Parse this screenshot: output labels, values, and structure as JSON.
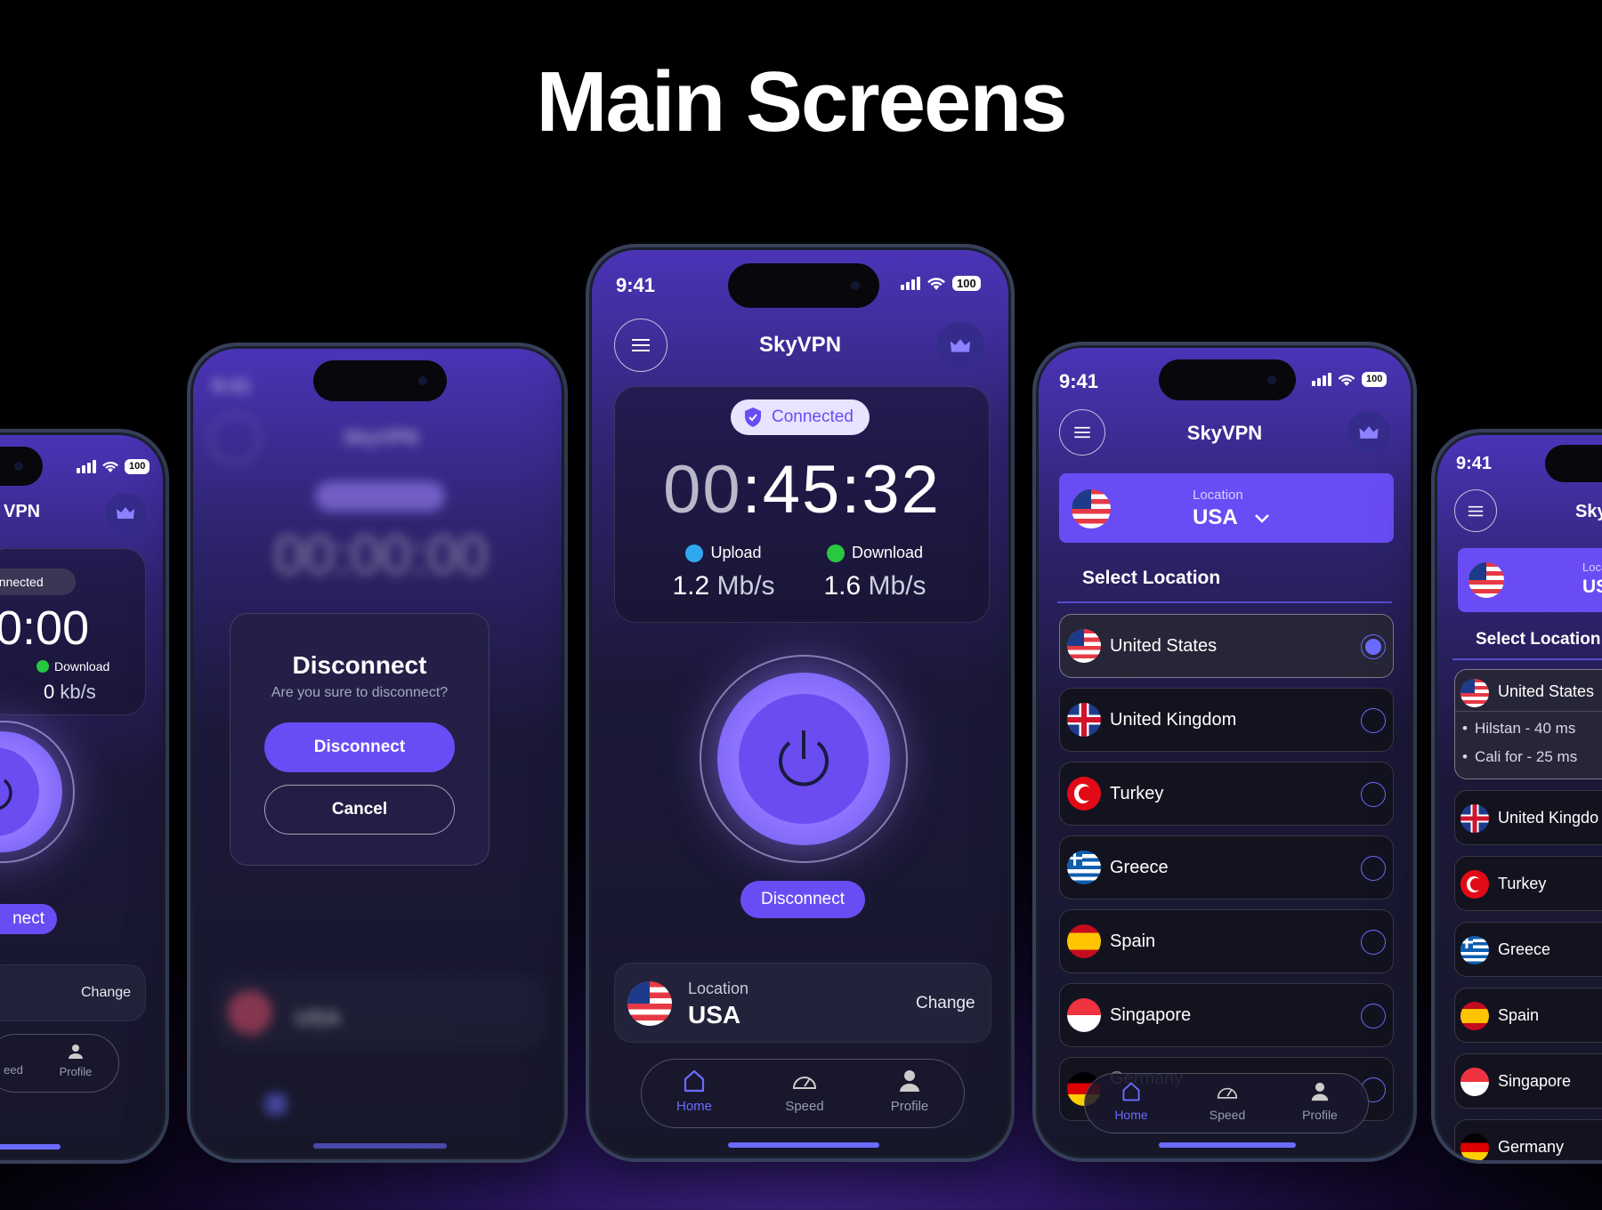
{
  "page_title": "Main Screens",
  "app_name": "SkyVPN",
  "status_time": "9:41",
  "battery": "100",
  "home_screen": {
    "status_label": "Connected",
    "timer_dim": "00",
    "timer_rest": ":45:32",
    "upload_label": "Upload",
    "upload_value": "1.2",
    "upload_unit": "Mb/s",
    "download_label": "Download",
    "download_value": "1.6",
    "download_unit": "Mb/s",
    "disconnect_label": "Disconnect",
    "location_label": "Location",
    "location_value": "USA",
    "change_label": "Change"
  },
  "tabs": {
    "home": "Home",
    "speed": "Speed",
    "profile": "Profile"
  },
  "left_screen": {
    "status_partial": "onnected",
    "timer_partial": "0:00",
    "download_label": "Download",
    "download_value": "0",
    "download_unit": "kb/s",
    "button_partial": "nect",
    "app_name_partial": "VPN",
    "change_label": "Change",
    "tab_partial": "eed"
  },
  "disconnect_dialog": {
    "blur_timer": "00:00:00",
    "blur_location": "USA",
    "title": "Disconnect",
    "message": "Are you sure to disconnect?",
    "confirm_label": "Disconnect",
    "cancel_label": "Cancel"
  },
  "location_screen": {
    "location_label": "Location",
    "location_value": "USA",
    "section_title": "Select Location",
    "countries": [
      {
        "name": "United States",
        "selected": true
      },
      {
        "name": "United Kingdom",
        "selected": false
      },
      {
        "name": "Turkey",
        "selected": false
      },
      {
        "name": "Greece",
        "selected": false
      },
      {
        "name": "Spain",
        "selected": false
      },
      {
        "name": "Singapore",
        "selected": false
      },
      {
        "name": "Germany",
        "selected": false
      }
    ]
  },
  "right_screen": {
    "app_name_partial": "Sky",
    "loc_label_partial": "Loca",
    "loc_value_partial": "US",
    "section_title_partial": "Select Location",
    "expanded_country": "United States",
    "servers": [
      "Hilstan - 40 ms",
      "Cali for - 25 ms"
    ],
    "countries_partial": [
      "United Kingdo",
      "Turkey",
      "Greece",
      "Spain",
      "Singapore",
      "Germany"
    ]
  }
}
